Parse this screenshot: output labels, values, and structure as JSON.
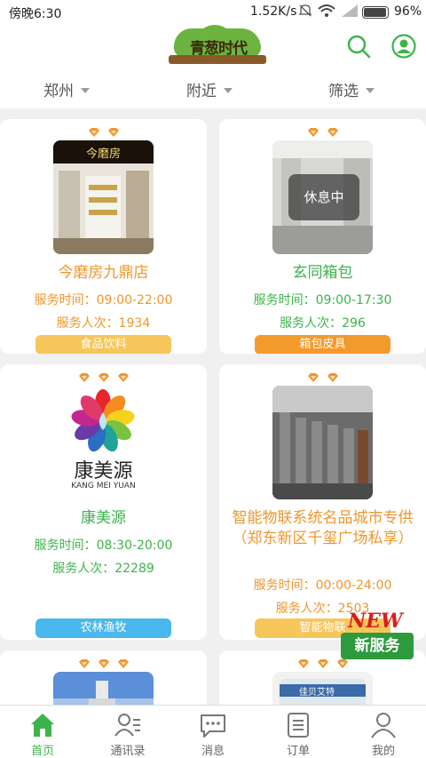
{
  "status": {
    "time": "傍晚6:30",
    "network": "1.52K/s",
    "battery": "96%"
  },
  "filters": {
    "city": "郑州",
    "nearby": "附近",
    "screen": "筛选"
  },
  "logo_text": "青葱时代",
  "cards": [
    {
      "title": "今磨房九鼎店",
      "hours": "服务时间：09:00-22:00",
      "count": "服务人次：1934",
      "tag": "食品饮料",
      "tag_color": "#f7c65a",
      "thumb_text": "今磨房"
    },
    {
      "title": "玄同箱包",
      "hours": "服务时间：09:00-17:30",
      "count": "服务人次：296",
      "tag": "箱包皮具",
      "tag_color": "#f39a2c",
      "overlay": "休息中"
    },
    {
      "title": "康美源",
      "hours": "服务时间：08:30-20:00",
      "count": "服务人次：22289",
      "tag": "农林渔牧",
      "tag_color": "#4ab8ec",
      "brand_cn": "康美源",
      "brand_en": "KANG MEI YUAN"
    },
    {
      "title": "智能物联系统名品城市专供（郑东新区千玺广场私享）",
      "hours": "服务时间：00:00-24:00",
      "count": "服务人次：2503",
      "tag": "智能物联",
      "tag_color": "#f7c65a"
    }
  ],
  "card6_label": "佳贝艾特",
  "new_badge": {
    "new": "NEW",
    "service": "新服务"
  },
  "tabs": [
    {
      "label": "首页"
    },
    {
      "label": "通讯录"
    },
    {
      "label": "消息"
    },
    {
      "label": "订单"
    },
    {
      "label": "我的"
    }
  ],
  "colors": {
    "accent": "#3cb44b",
    "orange": "#f0962b"
  }
}
